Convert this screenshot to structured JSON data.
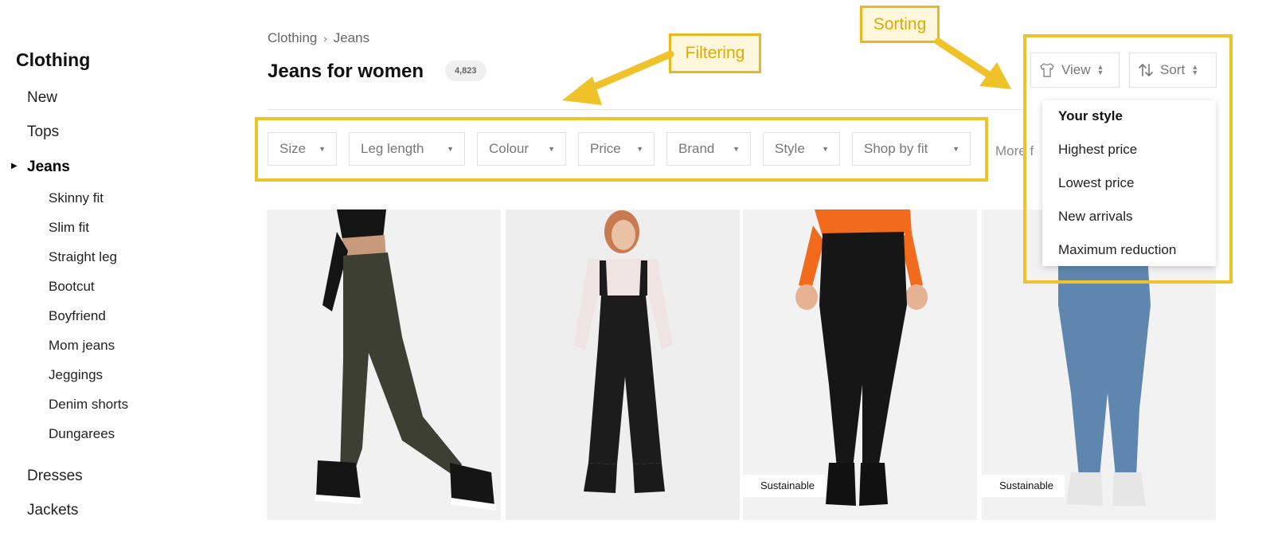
{
  "sidebar": {
    "title": "Clothing",
    "items": [
      {
        "label": "New"
      },
      {
        "label": "Tops"
      },
      {
        "label": "Jeans"
      },
      {
        "label": "Dresses"
      },
      {
        "label": "Jackets"
      }
    ],
    "subitems": [
      {
        "label": "Skinny fit"
      },
      {
        "label": "Slim fit"
      },
      {
        "label": "Straight leg"
      },
      {
        "label": "Bootcut"
      },
      {
        "label": "Boyfriend"
      },
      {
        "label": "Mom jeans"
      },
      {
        "label": "Jeggings"
      },
      {
        "label": "Denim shorts"
      },
      {
        "label": "Dungarees"
      }
    ]
  },
  "breadcrumb": {
    "items": [
      "Clothing",
      "Jeans"
    ],
    "separator": "›"
  },
  "header": {
    "title": "Jeans for women",
    "count": "4,823"
  },
  "filters": [
    {
      "label": "Size"
    },
    {
      "label": "Leg length"
    },
    {
      "label": "Colour"
    },
    {
      "label": "Price"
    },
    {
      "label": "Brand"
    },
    {
      "label": "Style"
    },
    {
      "label": "Shop by fit"
    }
  ],
  "more_filters": "More f",
  "view_button": {
    "label": "View",
    "icon": "shirt-icon"
  },
  "sort_button": {
    "label": "Sort",
    "icon": "sort-arrows-icon"
  },
  "sort_menu": {
    "options": [
      {
        "label": "Your style",
        "selected": true
      },
      {
        "label": "Highest price"
      },
      {
        "label": "Lowest price"
      },
      {
        "label": "New arrivals"
      },
      {
        "label": "Maximum reduction"
      }
    ]
  },
  "products": [
    {
      "garment": "khaki cargo skinny jeans",
      "pants_color": "#3d3f33",
      "top_color": "#141414",
      "shoe_color": "#151515",
      "badge": ""
    },
    {
      "garment": "black denim dungarees",
      "pants_color": "#1c1c1c",
      "top_color": "#f0e4e2",
      "shoe_color": "#1a1a1a",
      "badge": ""
    },
    {
      "garment": "black skinny jeans",
      "pants_color": "#161616",
      "top_color": "#f26a1b",
      "shoe_color": "#111111",
      "badge": "Sustainable"
    },
    {
      "garment": "blue skinny jeans",
      "pants_color": "#5f86ae",
      "top_color": "#d8d8d8",
      "shoe_color": "#e6e6e6",
      "badge": "Sustainable"
    }
  ],
  "annotations": {
    "filtering": "Filtering",
    "sorting": "Sorting"
  },
  "colors": {
    "annotation_border": "#f0c22a",
    "annotation_text": "#e0a800",
    "annotation_fill": "#fff8dc"
  }
}
